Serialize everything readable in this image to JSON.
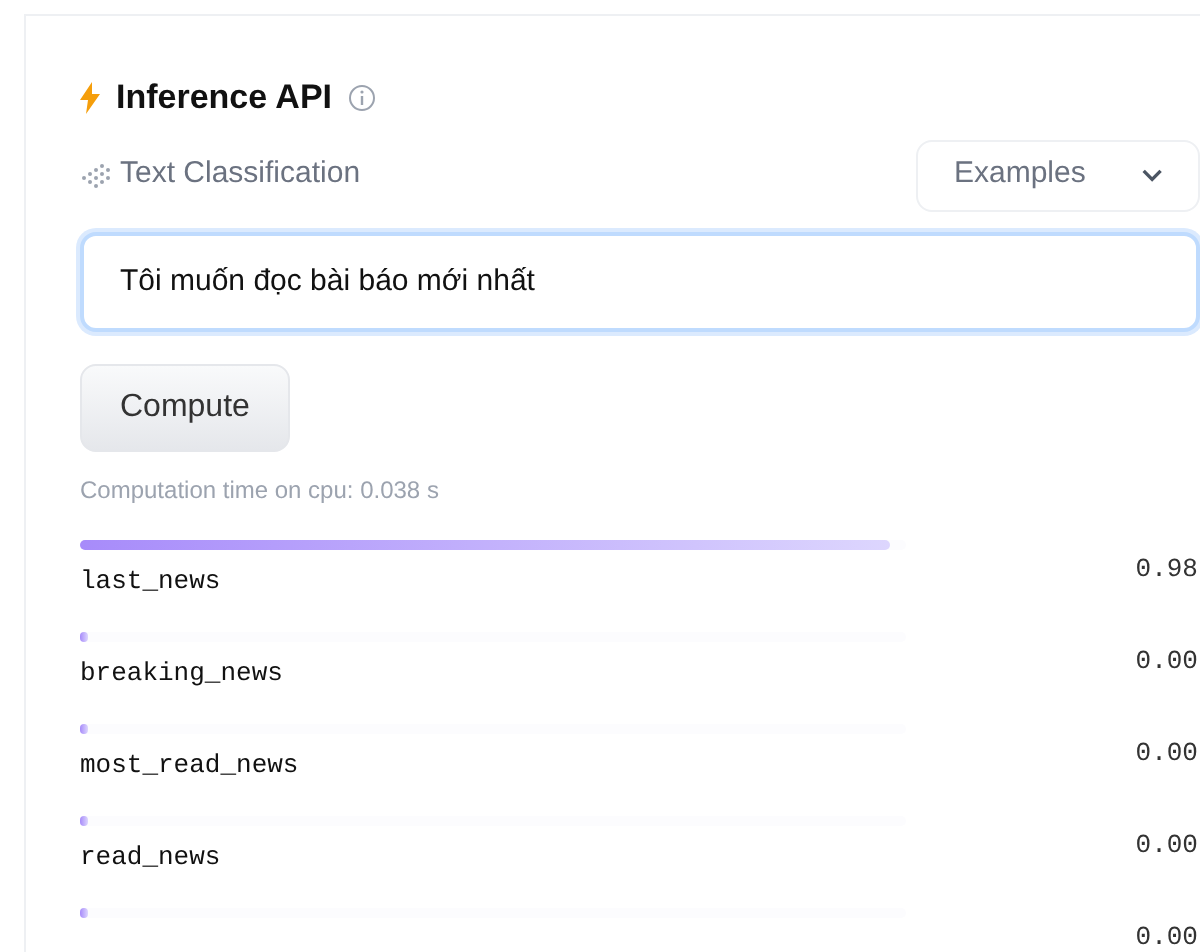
{
  "header": {
    "title": "Inference API"
  },
  "task": {
    "label": "Text Classification"
  },
  "examples": {
    "label": "Examples"
  },
  "input": {
    "value": "Tôi muốn đọc bài báo mới nhất"
  },
  "compute_button": "Compute",
  "computation_time": "Computation time on cpu: 0.038 s",
  "results": [
    {
      "label": "last_news",
      "level": 0.98,
      "score": "0.98"
    },
    {
      "label": "breaking_news",
      "level": 0.0,
      "score": "0.00"
    },
    {
      "label": "most_read_news",
      "level": 0.0,
      "score": "0.00"
    },
    {
      "label": "read_news",
      "level": 0.0,
      "score": "0.00"
    },
    {
      "level": 0.0,
      "score": "0.00"
    }
  ]
}
